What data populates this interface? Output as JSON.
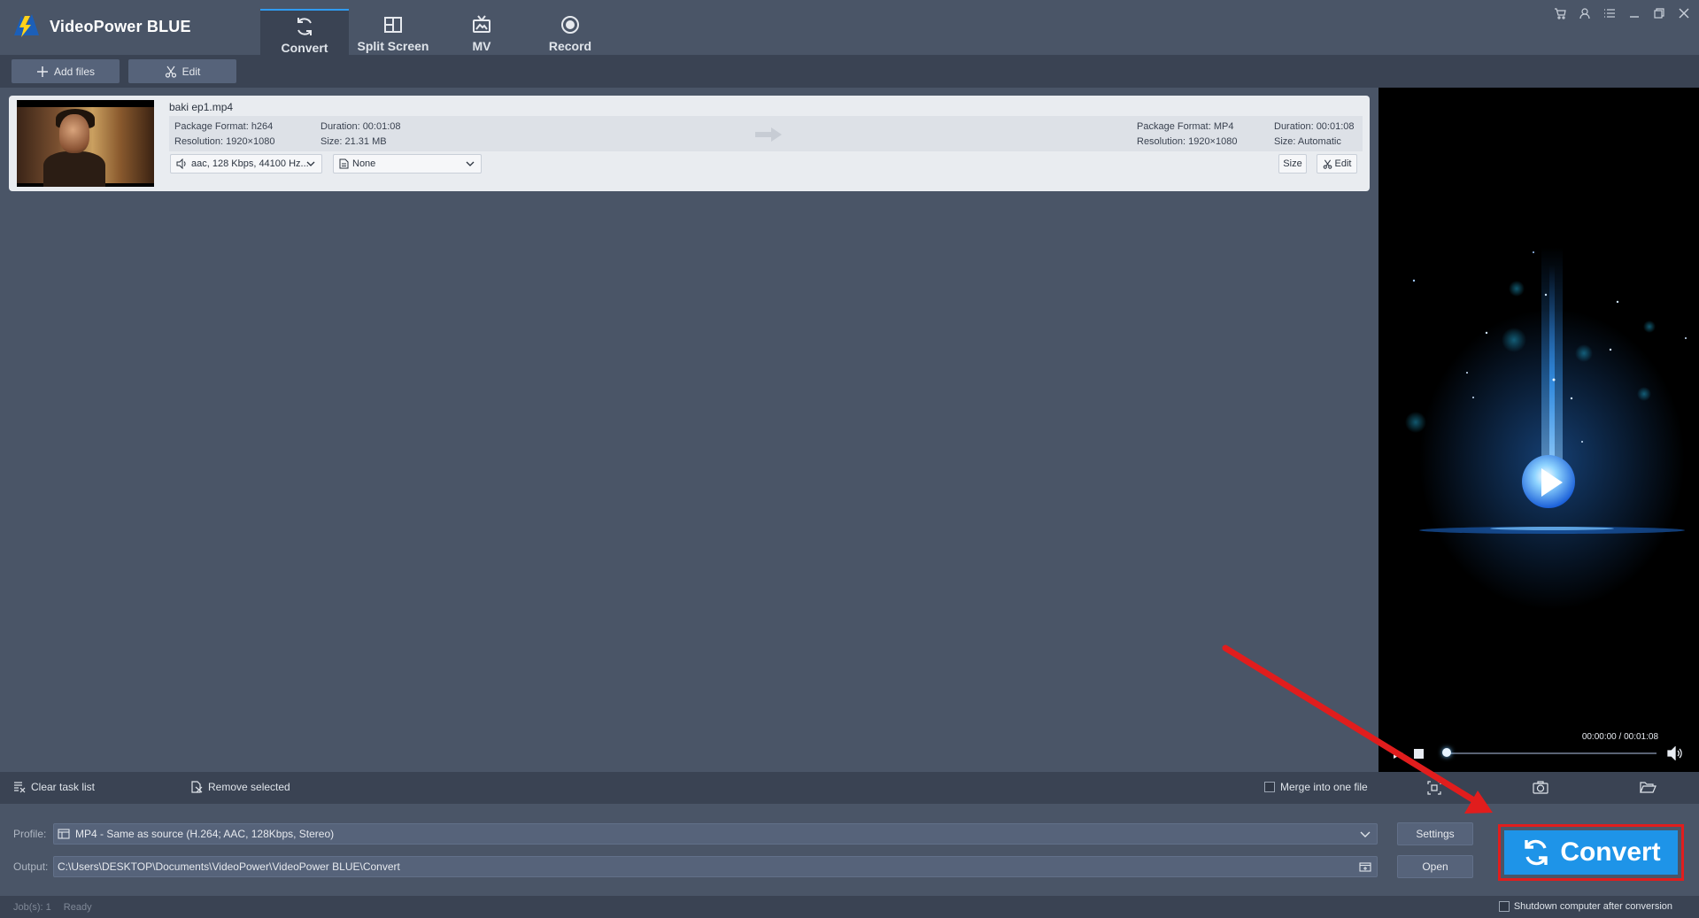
{
  "app": {
    "title": "VideoPower BLUE"
  },
  "tabs": [
    {
      "label": "Convert",
      "icon": "refresh-icon",
      "active": true
    },
    {
      "label": "Split Screen",
      "icon": "split-screen-icon"
    },
    {
      "label": "MV",
      "icon": "tv-icon"
    },
    {
      "label": "Record",
      "icon": "record-icon"
    }
  ],
  "window_controls": [
    "cart-icon",
    "user-icon",
    "menu-icon",
    "minimize-icon",
    "restore-icon",
    "close-icon"
  ],
  "toolbar": {
    "add_files": "Add files",
    "edit": "Edit"
  },
  "file": {
    "name": "baki ep1.mp4",
    "source": {
      "package_format": "Package Format: h264",
      "duration": "Duration: 00:01:08",
      "resolution": "Resolution: 1920×1080",
      "size": "Size: 21.31 MB"
    },
    "target": {
      "package_format": "Package Format: MP4",
      "duration": "Duration: 00:01:08",
      "resolution": "Resolution: 1920×1080",
      "size": "Size: Automatic"
    },
    "audio_track": "aac, 128 Kbps, 44100 Hz...",
    "subtitle": "None",
    "size_button": "Size",
    "edit_button": "Edit"
  },
  "preview": {
    "time": "00:00:00 / 00:01:08",
    "progress": 0.0
  },
  "taskbar": {
    "clear": "Clear task list",
    "remove": "Remove selected",
    "merge": "Merge into one file"
  },
  "bottom": {
    "profile_label": "Profile:",
    "profile_value": "MP4 - Same as source (H.264; AAC, 128Kbps, Stereo)",
    "settings": "Settings",
    "output_label": "Output:",
    "output_value": "C:\\Users\\DESKTOP\\Documents\\VideoPower\\VideoPower BLUE\\Convert",
    "open": "Open",
    "convert": "Convert"
  },
  "status": {
    "jobs": "Job(s): 1",
    "state": "Ready",
    "shutdown": "Shutdown computer after conversion"
  },
  "colors": {
    "background": "#4a5567",
    "dark_bar": "#3a4353",
    "accent_blue": "#1e94e8",
    "highlight_red": "#e11d1d"
  }
}
